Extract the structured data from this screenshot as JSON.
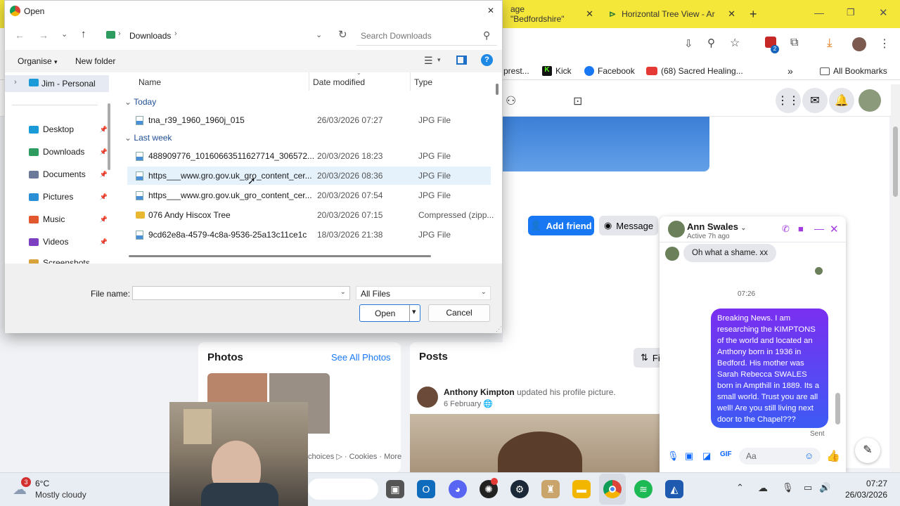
{
  "chrome": {
    "tabs": [
      {
        "label": "age \"Bedfordshire\"",
        "close": "✕"
      },
      {
        "label": "Horizontal Tree View - Ar",
        "close": "✕"
      }
    ],
    "new_tab": "+",
    "bookmarks": [
      "prest...",
      "Kick",
      "Facebook",
      "(68) Sacred Healing...",
      "All Bookmarks"
    ],
    "more": "»",
    "extension_badge": "2"
  },
  "facebook": {
    "add_friend": "Add friend",
    "message": "Message",
    "filters_partial": "Fi",
    "photos": {
      "title": "Photos",
      "see_all": "See All Photos"
    },
    "footer_links": "choices ▷ · Cookies · More",
    "posts": {
      "title": "Posts",
      "author": "Anthony Kimpton",
      "action": "updated his profile picture.",
      "date": "6 February"
    }
  },
  "messenger": {
    "name": "Ann Swales",
    "status": "Active 7h ago",
    "incoming": "Oh what a shame. xx",
    "time": "07:26",
    "outgoing": "Breaking News. I am researching the KIMPTONS of the world and located an Anthony born in 1936 in Bedford. His mother was Sarah Rebecca SWALES born in Ampthill in 1889. Its a small world. Trust you are all well! Are you still living next door to the Chapel???",
    "sent": "Sent",
    "composer_placeholder": "Aa"
  },
  "dialog": {
    "title": "Open",
    "close": "✕",
    "breadcrumb": "Downloads",
    "search_placeholder": "Search Downloads",
    "organise": "Organise",
    "new_folder": "New folder",
    "help": "?",
    "nav": {
      "root": "Jim - Personal",
      "items": [
        {
          "label": "Desktop",
          "color": "#1a9bd8"
        },
        {
          "label": "Downloads",
          "color": "#2e9b5f"
        },
        {
          "label": "Documents",
          "color": "#6b7a99"
        },
        {
          "label": "Pictures",
          "color": "#2b8fd6"
        },
        {
          "label": "Music",
          "color": "#e2582e"
        },
        {
          "label": "Videos",
          "color": "#7b3fc0"
        },
        {
          "label": "Screenshots",
          "color": "#d9a33b"
        }
      ]
    },
    "columns": {
      "name": "Name",
      "date": "Date modified",
      "type": "Type"
    },
    "groups": [
      "Today",
      "Last week"
    ],
    "files": [
      {
        "name": "tna_r39_1960_1960j_015",
        "date": "26/03/2026 07:27",
        "type": "JPG File",
        "kind": "image"
      },
      {
        "name": "488909776_10160663511627714_306572...",
        "date": "20/03/2026 18:23",
        "type": "JPG File",
        "kind": "image"
      },
      {
        "name": "https___www.gro.gov.uk_gro_content_cer...",
        "date": "20/03/2026 08:36",
        "type": "JPG File",
        "kind": "image"
      },
      {
        "name": "https___www.gro.gov.uk_gro_content_cer...",
        "date": "20/03/2026 07:54",
        "type": "JPG File",
        "kind": "image"
      },
      {
        "name": "076 Andy Hiscox Tree",
        "date": "20/03/2026 07:15",
        "type": "Compressed (zipp...",
        "kind": "zip"
      },
      {
        "name": "9cd62e8a-4579-4c8a-9536-25a13c11ce1c",
        "date": "18/03/2026 21:38",
        "type": "JPG File",
        "kind": "image"
      }
    ],
    "filename_label": "File name:",
    "filename_value": "",
    "filter": "All Files",
    "open": "Open",
    "cancel": "Cancel"
  },
  "taskbar": {
    "weather_badge": "3",
    "temperature": "6°C",
    "condition": "Mostly cloudy",
    "time": "07:27",
    "date": "26/03/2026"
  }
}
